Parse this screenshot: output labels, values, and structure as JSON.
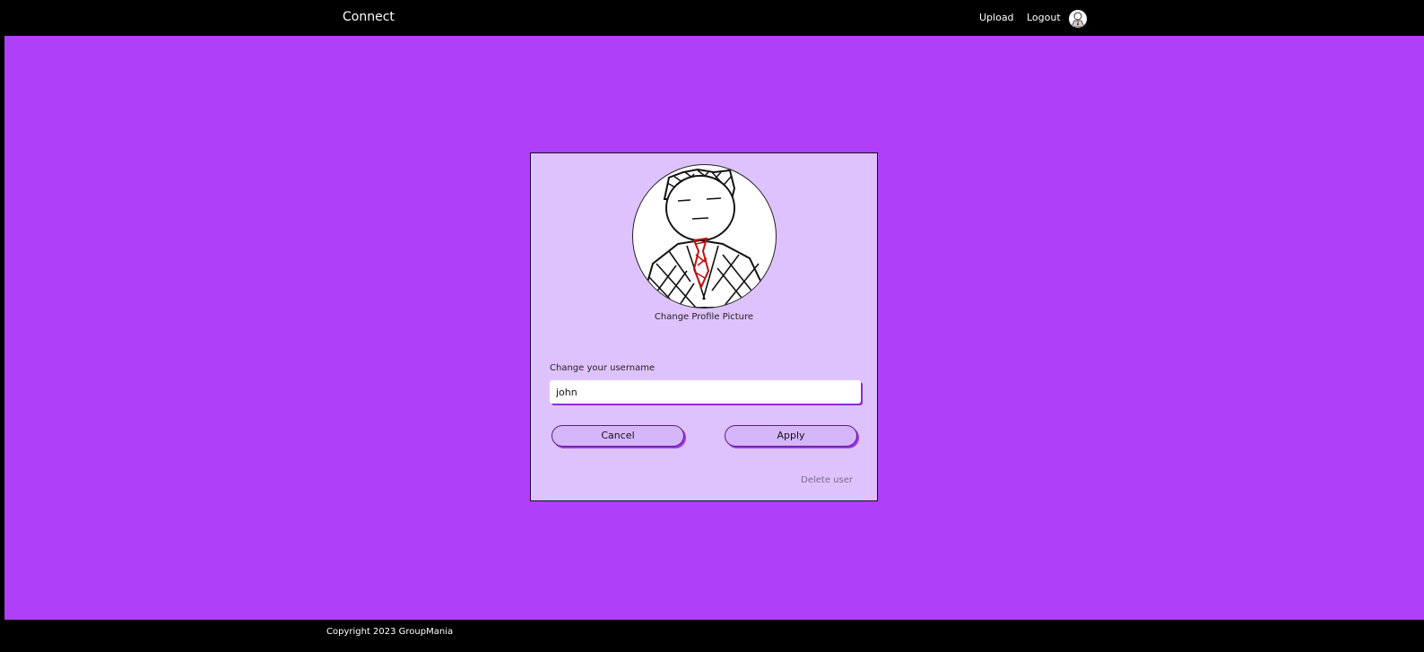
{
  "navbar": {
    "brand": "Connect",
    "upload": "Upload",
    "logout": "Logout",
    "avatar_icon": "user-avatar-icon"
  },
  "profile": {
    "picture_icon": "profile-picture-drawing",
    "change_picture_label": "Change Profile Picture"
  },
  "username": {
    "label": "Change your username",
    "value": "john"
  },
  "actions": {
    "cancel": "Cancel",
    "apply": "Apply",
    "delete_user": "Delete user"
  },
  "footer": {
    "copyright": "Copyright 2023 GroupMania"
  },
  "colors": {
    "background": "#b03ffa",
    "card": "#dec2fd",
    "bar": "#000000"
  }
}
